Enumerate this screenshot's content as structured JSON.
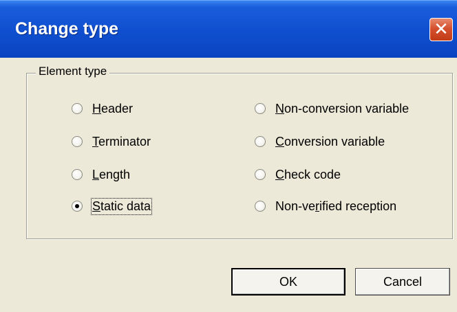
{
  "window": {
    "title": "Change type",
    "close_glyph": "✕"
  },
  "group": {
    "label": "Element type"
  },
  "options": [
    {
      "label": "Header",
      "accel": "H",
      "checked": false
    },
    {
      "label": "Terminator",
      "accel": "T",
      "checked": false
    },
    {
      "label": "Length",
      "accel": "L",
      "checked": false
    },
    {
      "label": "Static data",
      "accel": "S",
      "checked": true
    },
    {
      "label": "Non-conversion variable",
      "accel": "N",
      "checked": false
    },
    {
      "label": "Conversion variable",
      "accel": "C",
      "checked": false
    },
    {
      "label": "Check code",
      "accel": "C",
      "checked": false
    },
    {
      "label": "Non-verified reception",
      "accel": "r",
      "checked": false
    }
  ],
  "buttons": {
    "ok": "OK",
    "cancel": "Cancel"
  },
  "colors": {
    "titlebar": "#0f4fcf",
    "dialog_bg": "#ece9d8",
    "close": "#d4502e"
  }
}
